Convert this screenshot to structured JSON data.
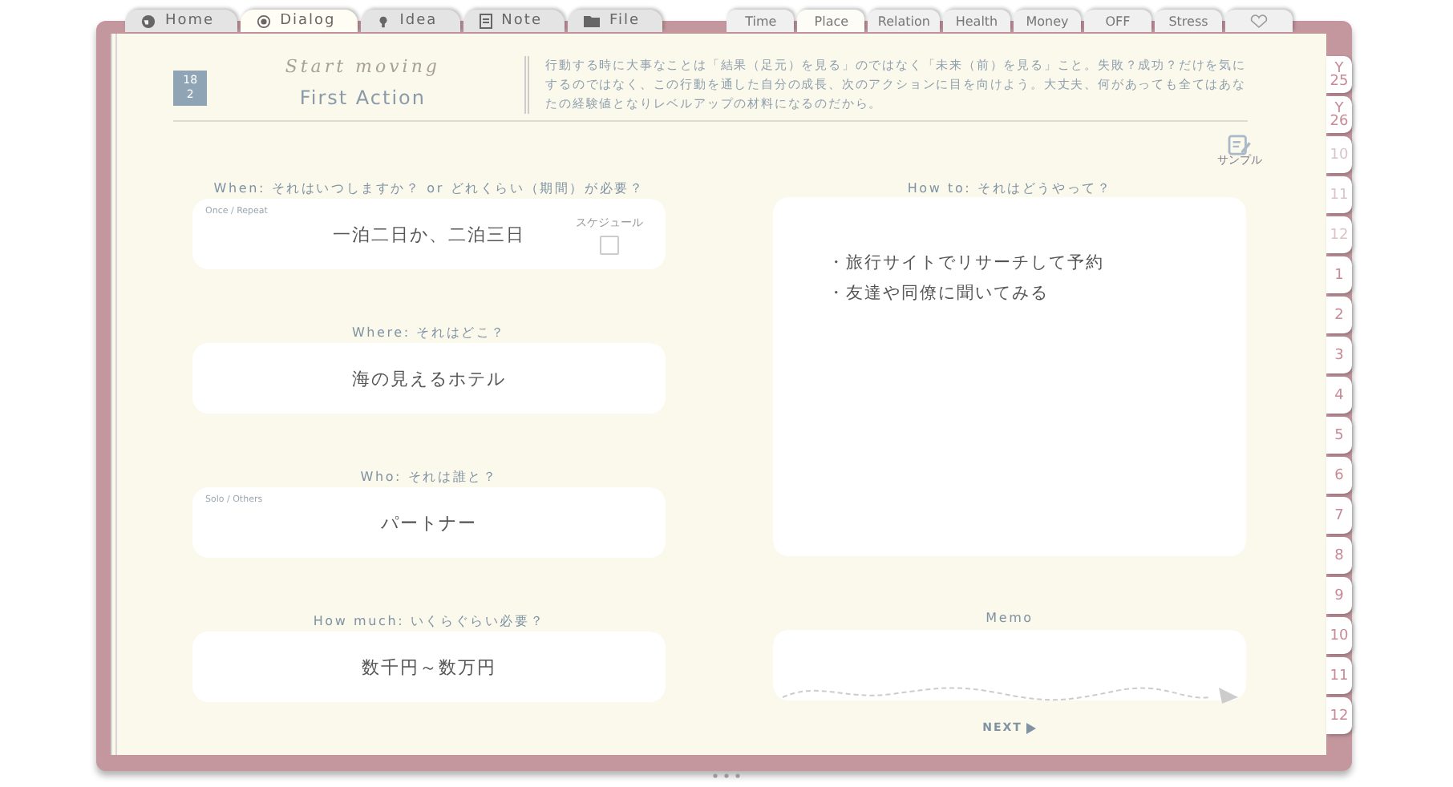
{
  "nav_tabs": [
    {
      "label": "Home",
      "selected": false
    },
    {
      "label": "Dialog",
      "selected": true
    },
    {
      "label": "Idea",
      "selected": false
    },
    {
      "label": "Note",
      "selected": false
    },
    {
      "label": "File",
      "selected": false
    }
  ],
  "category_tabs": [
    {
      "label": "Time",
      "selected": false
    },
    {
      "label": "Place",
      "selected": true
    },
    {
      "label": "Relation",
      "selected": false
    },
    {
      "label": "Health",
      "selected": false
    },
    {
      "label": "Money",
      "selected": false
    },
    {
      "label": "OFF",
      "selected": false
    },
    {
      "label": "Stress",
      "selected": false
    }
  ],
  "side_tabs": [
    {
      "top": "Y",
      "label": "25",
      "muted": false
    },
    {
      "top": "Y",
      "label": "26",
      "muted": false
    },
    {
      "label": "10",
      "muted": true
    },
    {
      "label": "11",
      "muted": true
    },
    {
      "label": "12",
      "muted": true
    },
    {
      "label": "1",
      "muted": false
    },
    {
      "label": "2",
      "muted": false
    },
    {
      "label": "3",
      "muted": false
    },
    {
      "label": "4",
      "muted": false
    },
    {
      "label": "5",
      "muted": false
    },
    {
      "label": "6",
      "muted": false
    },
    {
      "label": "7",
      "muted": false
    },
    {
      "label": "8",
      "muted": false
    },
    {
      "label": "9",
      "muted": false
    },
    {
      "label": "10",
      "muted": false
    },
    {
      "label": "11",
      "muted": false
    },
    {
      "label": "12",
      "muted": false
    }
  ],
  "header": {
    "badge": [
      "18",
      "2"
    ],
    "script_title": "Start moving",
    "title": "First Action",
    "text": "行動する時に大事なことは「結果（足元）を見る」のではなく「未来（前）を見る」こと。失敗？成功？だけを気にするのではなく、この行動を通した自分の成長、次のアクションに目を向けよう。大丈夫、何があっても全てはあなたの経験値となりレベルアップの材料になるのだから。"
  },
  "questions": [
    {
      "label": "When: それはいつしますか？ or どれくらい（期間）が必要？",
      "hint": "Once / Repeat",
      "value": "一泊二日か、二泊三日",
      "schedule": {
        "label": "スケジュール",
        "checked": false
      }
    },
    {
      "label": "Where: それはどこ？",
      "value": "海の見えるホテル"
    },
    {
      "label": "Who: それは誰と？",
      "hint": "Solo / Others",
      "value": "パートナー"
    },
    {
      "label": "How much: いくらぐらい必要？",
      "value": "数千円～数万円"
    }
  ],
  "sample": {
    "label": "サンプル"
  },
  "how_to": {
    "label": "How to: それはどうやって？",
    "lines": [
      "・旅行サイトでリサーチして予約",
      "・友達や同僚に聞いてみる"
    ]
  },
  "memo": {
    "label": "Memo"
  },
  "next": {
    "label": "NEXT"
  }
}
